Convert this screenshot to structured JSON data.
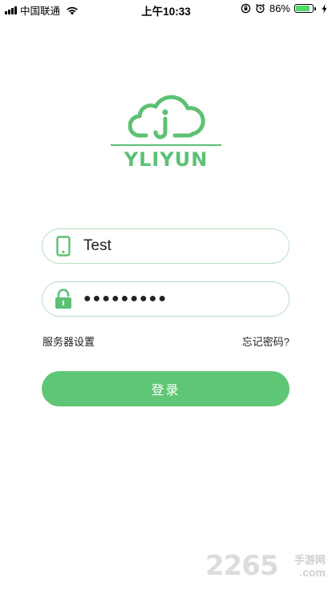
{
  "status_bar": {
    "carrier": "中国联通",
    "time": "上午10:33",
    "battery_percent": "86%",
    "battery_level": 0.86
  },
  "logo": {
    "text": "YLIYUN",
    "icon": "cloud-i-icon"
  },
  "form": {
    "username_value": "Test",
    "password_dots": "●●●●●●●●●",
    "username_icon": "phone-icon",
    "password_icon": "lock-icon"
  },
  "links": {
    "server_settings": "服务器设置",
    "forgot_password": "忘记密码?"
  },
  "login_button": {
    "label": "登录"
  },
  "watermark": {
    "number": "2265",
    "site": "手游网",
    "domain": ".com"
  },
  "colors": {
    "brand_green": "#5dc173",
    "button_green": "#5fc675",
    "field_border": "#b4dfbd"
  }
}
